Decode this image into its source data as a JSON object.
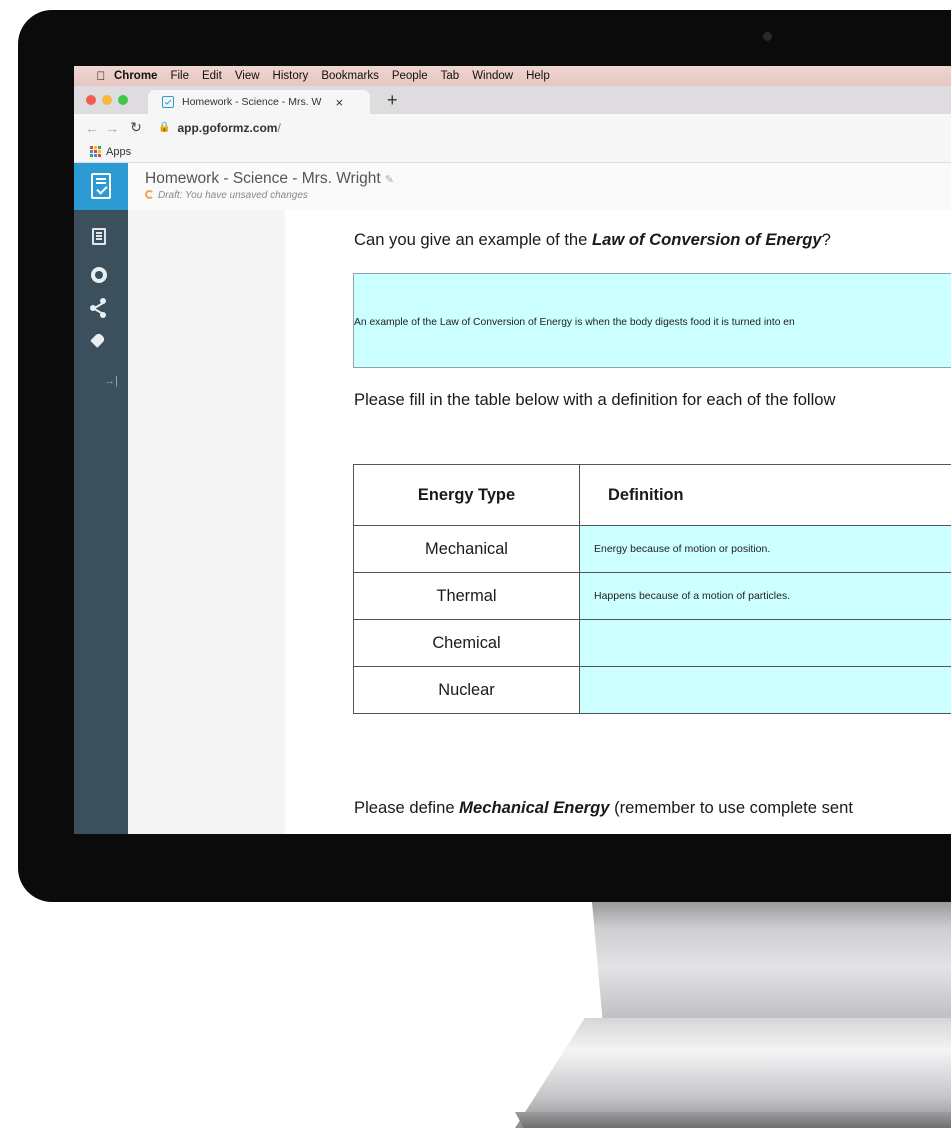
{
  "menubar": {
    "items": [
      "Chrome",
      "File",
      "Edit",
      "View",
      "History",
      "Bookmarks",
      "People",
      "Tab",
      "Window",
      "Help"
    ]
  },
  "browser": {
    "tab_title": "Homework - Science - Mrs. W",
    "tab_close": "×",
    "new_tab": "+",
    "url_host": "app.goformz.com",
    "url_path": "/",
    "bookmark_apps": "Apps"
  },
  "app": {
    "form_title": "Homework - Science - Mrs. Wright",
    "draft_status": "Draft: You have unsaved changes"
  },
  "document": {
    "q1_pre": "Can you give an example of the ",
    "q1_em": "Law of Conversion of Energy",
    "q1_post": "?",
    "q1_answer": "An example of the Law of Conversion of Energy is when the body digests food it is turned into en",
    "q2": "Please fill in the table below with a definition for each of the follow",
    "table": {
      "header_type": "Energy Type",
      "header_def": "Definition",
      "rows": [
        {
          "type": "Mechanical",
          "definition": "Energy because of motion or position."
        },
        {
          "type": "Thermal",
          "definition": "Happens because of a motion of particles."
        },
        {
          "type": "Chemical",
          "definition": ""
        },
        {
          "type": "Nuclear",
          "definition": ""
        }
      ]
    },
    "q3_pre": "Please define ",
    "q3_em": "Mechanical Energy",
    "q3_post": " (remember to use complete sent"
  },
  "colors": {
    "accent": "#2c9ad3",
    "sidebar": "#3b4f5d",
    "answer_fill": "#ccffff",
    "menubar": "#e8cac5"
  },
  "icons": [
    "apple-icon",
    "close-dot-icon",
    "minimize-dot-icon",
    "zoom-dot-icon",
    "form-favicon-icon",
    "back-icon",
    "forward-icon",
    "reload-icon",
    "lock-icon",
    "apps-grid-icon",
    "clipboard-check-icon",
    "pencil-icon",
    "spinner-icon",
    "pdf-icon",
    "refresh-icon",
    "share-icon",
    "tag-icon",
    "collapse-icon"
  ]
}
